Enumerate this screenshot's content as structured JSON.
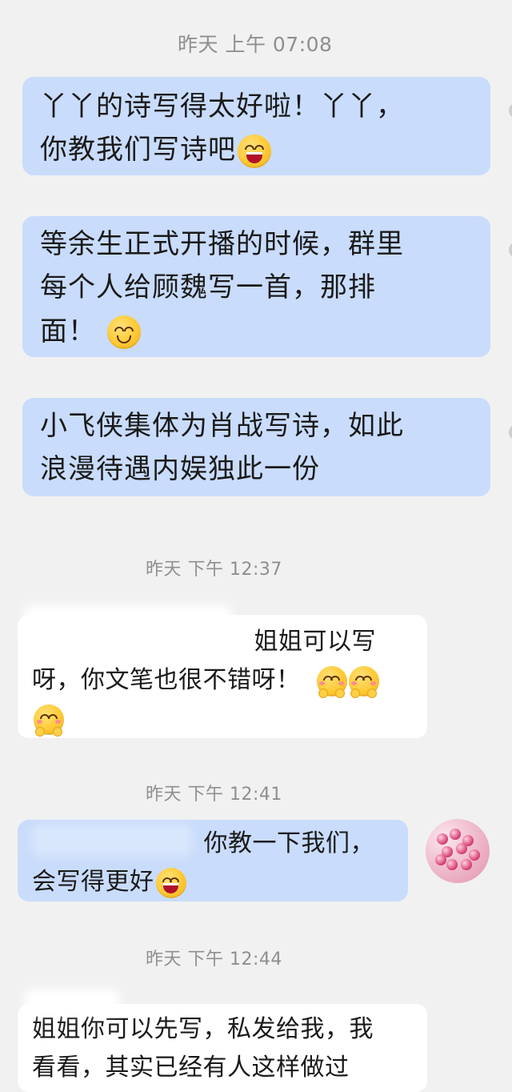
{
  "timestamps": [
    "昨天 上午 07:08",
    "昨天 下午 12:37",
    "昨天 下午 12:41",
    "昨天 下午 12:44"
  ],
  "messages": [
    {
      "side": "right",
      "line1": "丫丫的诗写得太好啦！丫丫，",
      "line2": "你教我们写诗吧",
      "emoji": "laughing-emoji"
    },
    {
      "side": "right",
      "line1": "等余生正式开播的时候，群里",
      "line2": "每个人给顾魏写一首，那排",
      "line3": "面！",
      "emoji": "smirk-emoji"
    },
    {
      "side": "right",
      "line1": "小飞侠集体为肖战写诗，如此",
      "line2": "浪漫待遇内娱独此一份"
    },
    {
      "side": "left",
      "line1": "姐姐可以写",
      "line2": "呀，你文笔也很不错呀！",
      "emoji": "cute-blush-emoji"
    },
    {
      "side": "right",
      "line1": "你教一下我们，",
      "line2": "会写得更好",
      "emoji": "laughing-emoji"
    },
    {
      "side": "left",
      "line1": "姐姐你可以先写，私发给我，我",
      "line2": "看看，其实已经有人这样做过"
    }
  ],
  "colors": {
    "background": "#f1f1f1",
    "outgoing_bubble": "#c9dcfb",
    "incoming_bubble": "#ffffff",
    "timestamp": "#8f8f8f"
  }
}
